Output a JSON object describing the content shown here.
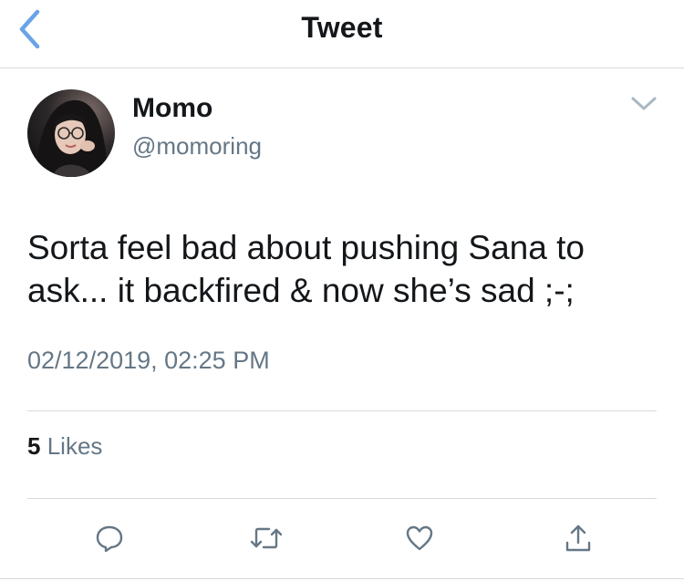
{
  "header": {
    "title": "Tweet",
    "back_icon": "chevron-left-icon"
  },
  "author": {
    "name": "Momo",
    "handle": "@momoring"
  },
  "tweet": {
    "text": "Sorta feel bad about pushing Sana to ask... it backfired & now she’s sad ;-;",
    "timestamp": "02/12/2019, 02:25 PM"
  },
  "stats": {
    "likes_count": "5",
    "likes_label": "Likes"
  },
  "actions": [
    {
      "icon": "reply-icon"
    },
    {
      "icon": "retweet-icon"
    },
    {
      "icon": "like-icon"
    },
    {
      "icon": "share-icon"
    }
  ],
  "colors": {
    "accent": "#4a90e2",
    "text": "#14171a",
    "secondary": "#657786",
    "divider": "#d6d9dc"
  }
}
